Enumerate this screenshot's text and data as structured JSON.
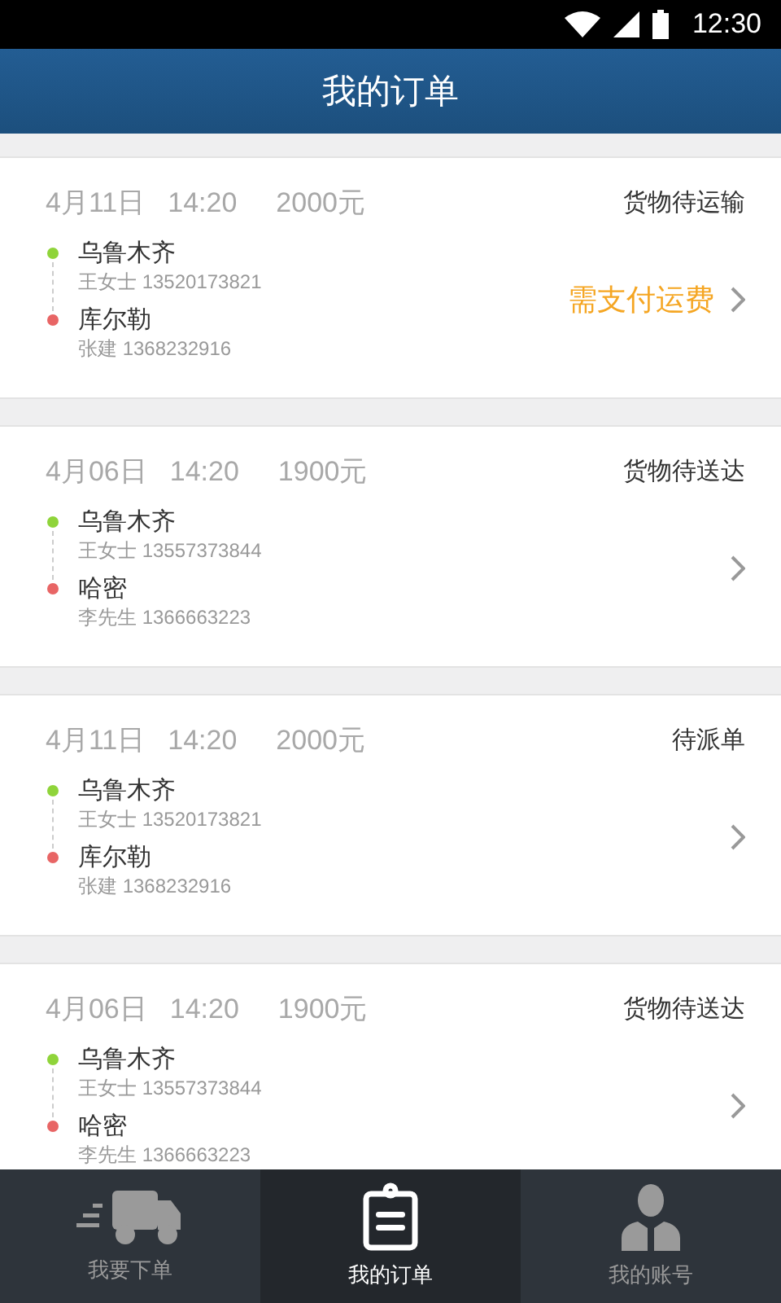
{
  "status_bar": {
    "time": "12:30"
  },
  "header": {
    "title": "我的订单"
  },
  "orders": [
    {
      "date": "4月11日",
      "time": "14:20",
      "price": "2000元",
      "status": "货物待运输",
      "origin": {
        "city": "乌鲁木齐",
        "contact": "王女士 13520173821"
      },
      "destination": {
        "city": "库尔勒",
        "contact": "张建 1368232916"
      },
      "action": "需支付运费"
    },
    {
      "date": "4月06日",
      "time": "14:20",
      "price": "1900元",
      "status": "货物待送达",
      "origin": {
        "city": "乌鲁木齐",
        "contact": "王女士 13557373844"
      },
      "destination": {
        "city": "哈密",
        "contact": "李先生 1366663223"
      }
    },
    {
      "date": "4月11日",
      "time": "14:20",
      "price": "2000元",
      "status": "待派单",
      "origin": {
        "city": "乌鲁木齐",
        "contact": "王女士 13520173821"
      },
      "destination": {
        "city": "库尔勒",
        "contact": "张建 1368232916"
      }
    },
    {
      "date": "4月06日",
      "time": "14:20",
      "price": "1900元",
      "status": "货物待送达",
      "origin": {
        "city": "乌鲁木齐",
        "contact": "王女士 13557373844"
      },
      "destination": {
        "city": "哈密",
        "contact": "李先生 1366663223"
      }
    }
  ],
  "tabs": [
    {
      "label": "我要下单",
      "kind": "truck",
      "selected": false
    },
    {
      "label": "我的订单",
      "kind": "clipboard",
      "selected": true
    },
    {
      "label": "我的账号",
      "kind": "person",
      "selected": false
    }
  ]
}
